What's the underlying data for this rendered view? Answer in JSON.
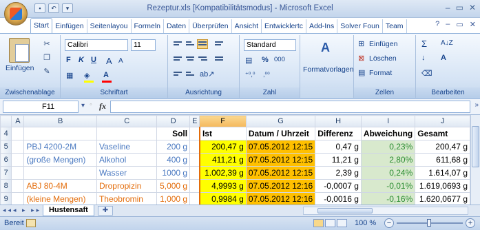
{
  "window": {
    "title": "Rezeptur.xls [Kompatibilitätsmodus] - Microsoft Excel",
    "controls": [
      "–",
      "▭",
      "✕"
    ]
  },
  "ribbon_tabs": [
    "Start",
    "Einfügen",
    "Seitenlayou",
    "Formeln",
    "Daten",
    "Überprüfen",
    "Ansicht",
    "Entwicklertc",
    "Add-Ins",
    "Solver Foun",
    "Team"
  ],
  "ribbon": {
    "clipboard": {
      "paste_label": "Einfügen",
      "group_label": "Zwischenablage"
    },
    "font": {
      "font_name": "Calibri",
      "font_size": "11",
      "bold": "F",
      "italic": "K",
      "underline": "U",
      "grow": "A",
      "shrink": "A",
      "group_label": "Schriftart",
      "fill_color": "#ffff00",
      "font_color": "#ff0000"
    },
    "alignment": {
      "group_label": "Ausrichtung"
    },
    "number": {
      "format": "Standard",
      "percent": "%",
      "thousands": "000",
      "dec_inc": "⁺⁰,⁰",
      "dec_dec": ",⁰⁰",
      "group_label": "Zahl"
    },
    "styles": {
      "label": "Formatvorlagen"
    },
    "cells": {
      "insert": "Einfügen",
      "delete": "Löschen",
      "format": "Format",
      "group_label": "Zellen"
    },
    "editing": {
      "sum": "Σ",
      "sort": "A↓Z",
      "fill": "↓",
      "find": "A",
      "clear": "⌫",
      "group_label": "Bearbeiten"
    }
  },
  "formula_bar": {
    "name_box": "F11",
    "fx": "fx",
    "formula": ""
  },
  "columns": [
    "A",
    "B",
    "C",
    "D",
    "E",
    "F",
    "G",
    "H",
    "I",
    "J"
  ],
  "rows": [
    {
      "num": "4",
      "B": "",
      "C": "",
      "D": "Soll",
      "F": "Ist",
      "G": "Datum / Uhrzeit",
      "H": "Differenz",
      "I": "Abweichung",
      "J": "Gesamt"
    },
    {
      "num": "5",
      "B": "PBJ 4200-2M",
      "C": "Vaseline",
      "D": "200 g",
      "F": "200,47 g",
      "G": "07.05.2012 12:15",
      "H": "0,47 g",
      "I": "0,23%",
      "J": "200,47 g"
    },
    {
      "num": "6",
      "B": "(große Mengen)",
      "C": "Alkohol",
      "D": "400 g",
      "F": "411,21 g",
      "G": "07.05.2012 12:15",
      "H": "11,21 g",
      "I": "2,80%",
      "J": "611,68 g"
    },
    {
      "num": "7",
      "B": "",
      "C": "Wasser",
      "D": "1000 g",
      "F": "1.002,39 g",
      "G": "07.05.2012 12:15",
      "H": "2,39 g",
      "I": "0,24%",
      "J": "1.614,07 g"
    },
    {
      "num": "8",
      "B": "ABJ 80-4M",
      "C": "Dropropizin",
      "D": "5,000 g",
      "F": "4,9993 g",
      "G": "07.05.2012 12:16",
      "H": "-0,0007 g",
      "I": "-0,01%",
      "J": "1.619,0693 g"
    },
    {
      "num": "9",
      "B": "(kleine Mengen)",
      "C": "Theobromin",
      "D": "1,000 g",
      "F": "0,9984 g",
      "G": "07.05.2012 12:16",
      "H": "-0,0016 g",
      "I": "-0,16%",
      "J": "1.620,0677 g"
    }
  ],
  "sheet_tabs": {
    "active": "Hustensaft"
  },
  "status": {
    "ready": "Bereit",
    "zoom": "100 %"
  },
  "colors": {
    "highlight_yellow": "#ffff00",
    "highlight_gold": "#ffc000",
    "deviation_green": "#d8e9cd",
    "product_blue": "#4a79c1",
    "product_orange": "#e36c0a"
  }
}
